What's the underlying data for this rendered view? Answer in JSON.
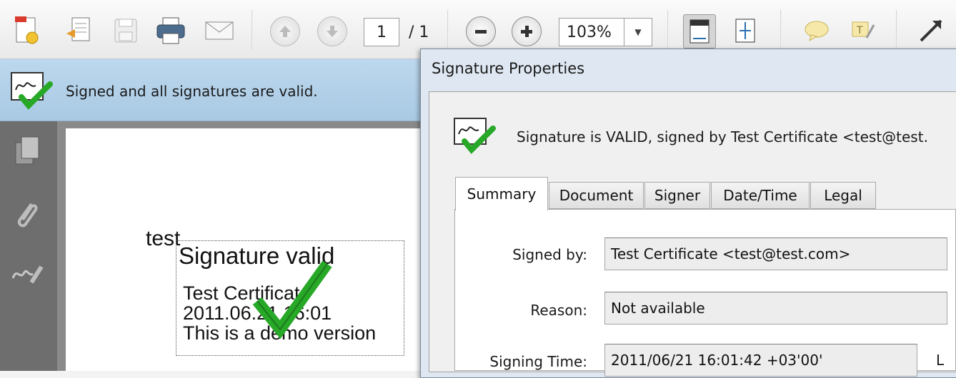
{
  "toolbar": {
    "page_current": "1",
    "page_total": "/ 1",
    "zoom": "103%",
    "icons": [
      "create-pdf-icon",
      "export-icon",
      "save-icon",
      "print-icon",
      "email-icon",
      "prev-page-icon",
      "next-page-icon",
      "zoom-out-icon",
      "zoom-in-icon",
      "fit-width-icon",
      "fit-page-icon",
      "comment-icon",
      "highlight-icon",
      "fullscreen-icon"
    ]
  },
  "signature_bar": {
    "message": "Signed and all signatures are valid."
  },
  "document": {
    "word": "test",
    "appearance": {
      "heading": "Signature valid",
      "signer": "Test Certificate",
      "date": "2011.06.21 16:01",
      "note": "This is a demo version"
    }
  },
  "dialog": {
    "title": "Signature Properties",
    "status": "Signature is VALID, signed by Test Certificate <test@test.",
    "tabs": [
      "Summary",
      "Document",
      "Signer",
      "Date/Time",
      "Legal"
    ],
    "active_tab": "Summary",
    "fields": {
      "signed_by_label": "Signed by:",
      "signed_by_value": "Test Certificate <test@test.com>",
      "reason_label": "Reason:",
      "reason_value": "Not available",
      "signing_time_label": "Signing Time:",
      "signing_time_value": "2011/06/21 16:01:42 +03'00'",
      "location_label_partial": "L"
    }
  },
  "colors": {
    "signature_bar": "#b3d1ea",
    "check_green": "#27a827",
    "dialog_frame": "#dfe8f2"
  }
}
